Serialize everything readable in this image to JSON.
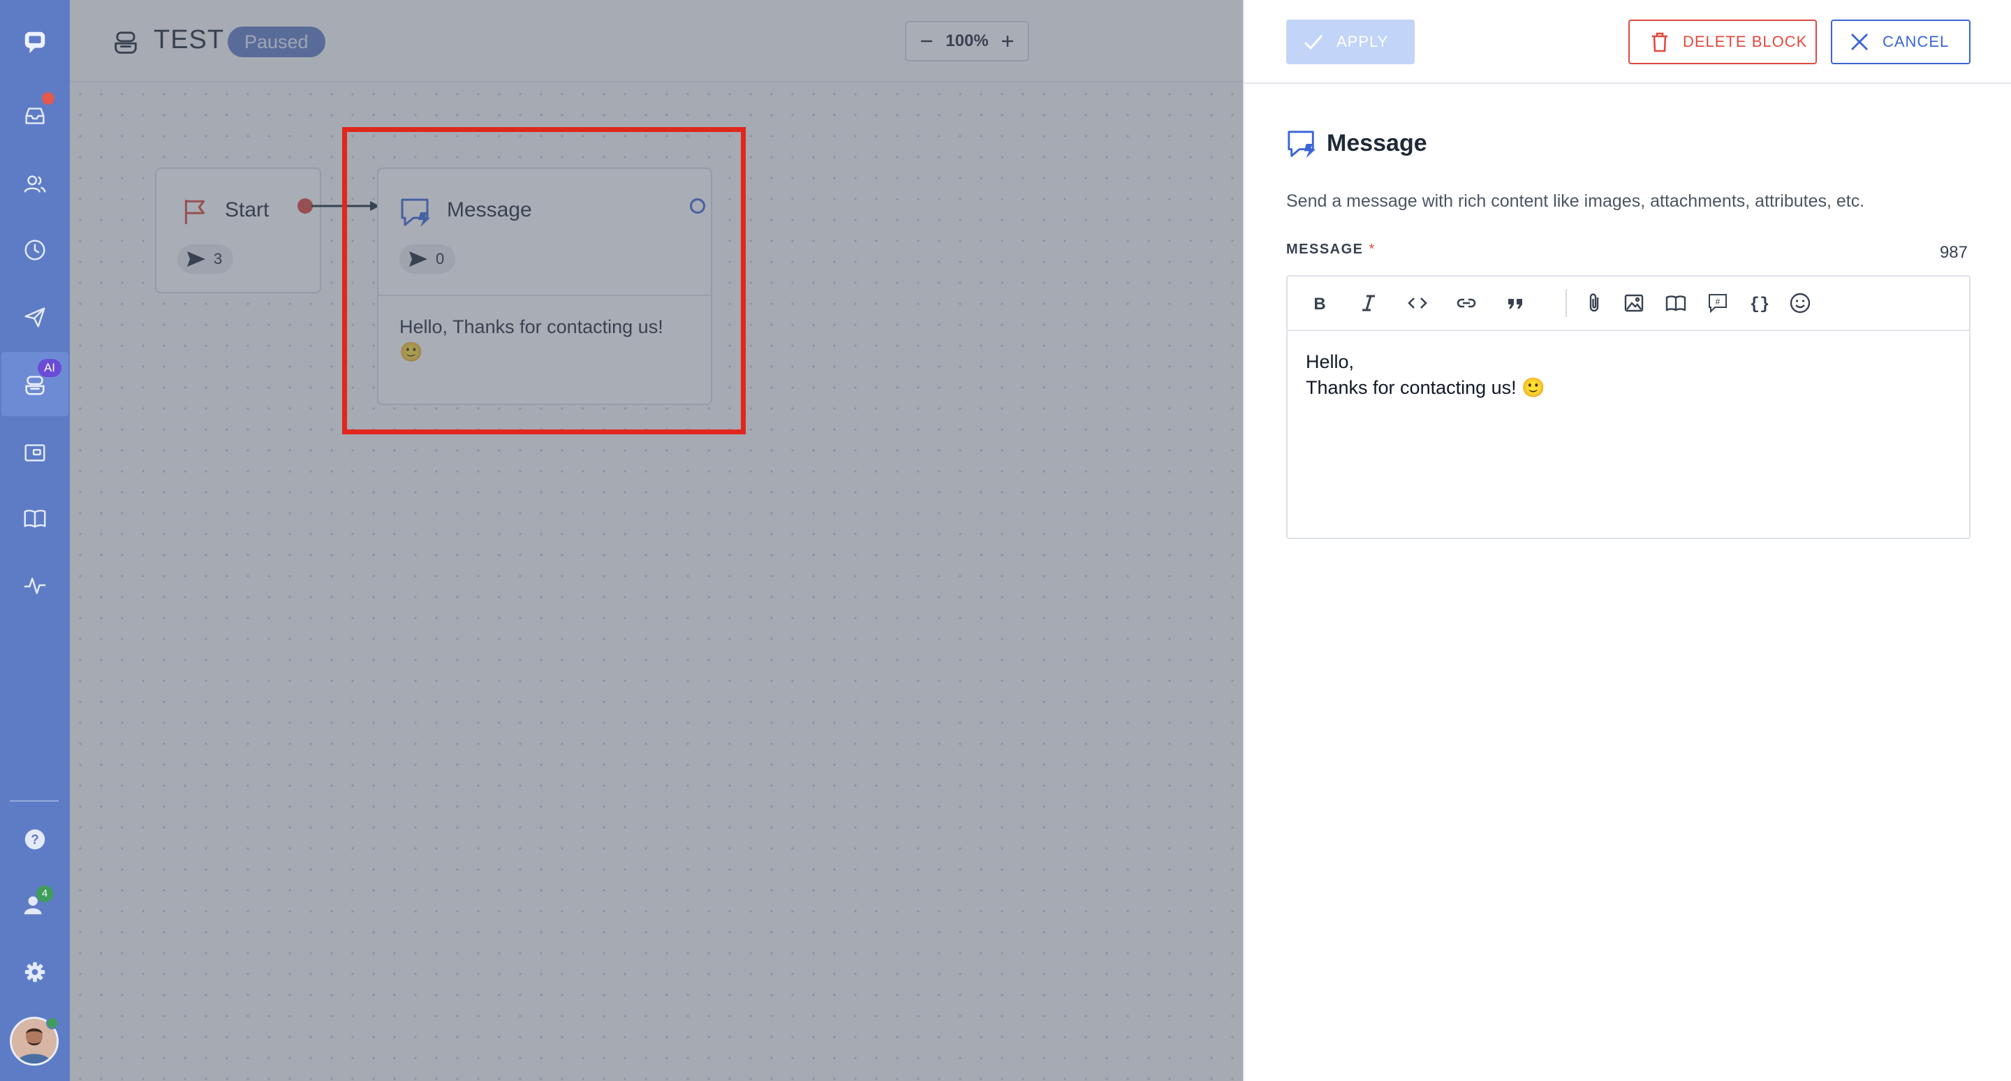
{
  "flow": {
    "title": "TEST",
    "status": "Paused",
    "zoom": "100%"
  },
  "nav": {
    "ai_badge": "AI",
    "contacts_count": "4"
  },
  "nodes": {
    "start": {
      "title": "Start",
      "count": "3"
    },
    "message": {
      "title": "Message",
      "count": "0",
      "preview_line1": "Hello, Thanks for contacting us!",
      "preview_emoji": "🙂"
    }
  },
  "panel": {
    "apply_label": "APPLY",
    "delete_label": "DELETE BLOCK",
    "cancel_label": "CANCEL",
    "title": "Message",
    "description": "Send a message with rich content like images, attachments, attributes, etc.",
    "field_label": "MESSAGE",
    "required_mark": "*",
    "char_count": "987",
    "message_line1": "Hello,",
    "message_line2": "Thanks for contacting us! 🙂"
  },
  "colors": {
    "nav_bg": "#5e7cc6",
    "accent_blue": "#3a64d8",
    "danger": "#e0493f",
    "highlight": "#e1261c"
  }
}
